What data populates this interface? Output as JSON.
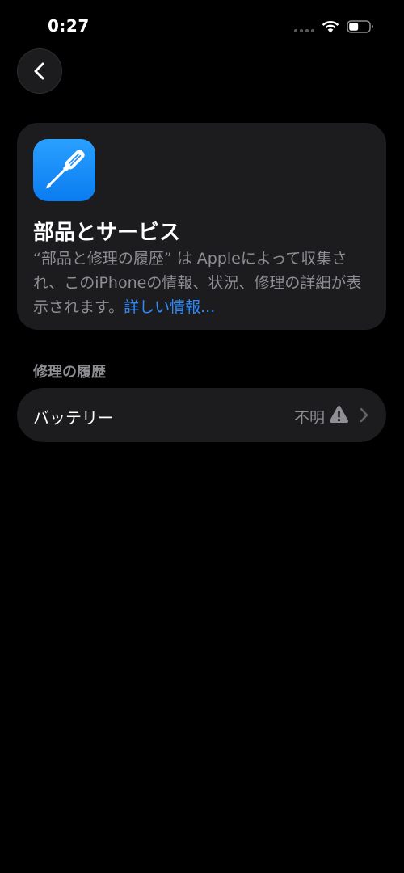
{
  "status_bar": {
    "time": "0:27"
  },
  "card": {
    "title": "部品とサービス",
    "description": "“部品と修理の履歴” は Appleによって収集され、このiPhoneの情報、状況、修理の詳細が表示されます。",
    "more_link": "詳しい情報..."
  },
  "repair_history": {
    "section_title": "修理の履歴",
    "items": [
      {
        "label": "バッテリー",
        "value": "不明"
      }
    ]
  },
  "icons": {
    "back": "chevron-left-icon",
    "app": "screwdriver-icon",
    "status": "warning-icon",
    "disclosure": "chevron-right-icon"
  },
  "colors": {
    "background": "#000000",
    "card": "#1c1c1e",
    "secondary_text": "#8e8e93",
    "link": "#2d8cff",
    "app_icon": "#1a8cff"
  }
}
